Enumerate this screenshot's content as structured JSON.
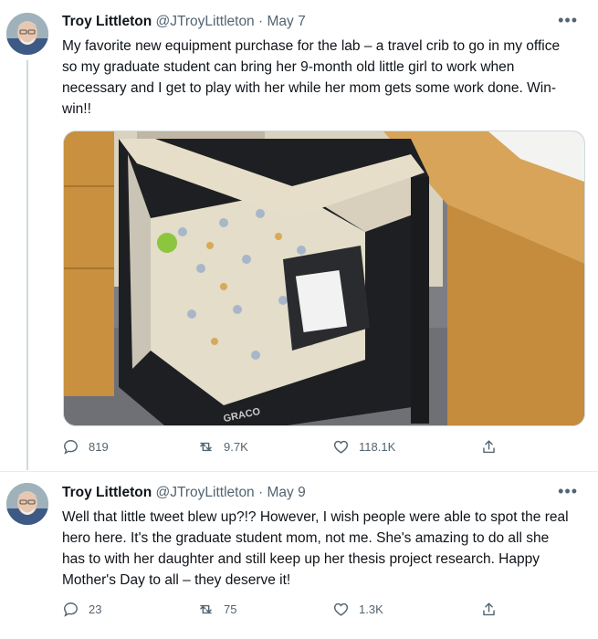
{
  "tweets": [
    {
      "author_name": "Troy Littleton",
      "handle": "@JTroyLittleton",
      "separator": "·",
      "date": "May 7",
      "more": "•••",
      "text": "My favorite new equipment purchase for the lab – a travel crib to go in my office so my graduate student can bring her 9-month old little girl to work when necessary and I get to play with her while her mom gets some work done. Win-win!!",
      "media_logo": "GRACO",
      "replies": "819",
      "retweets": "9.7K",
      "likes": "118.1K"
    },
    {
      "author_name": "Troy Littleton",
      "handle": "@JTroyLittleton",
      "separator": "·",
      "date": "May 9",
      "more": "•••",
      "text": "Well that little tweet blew up?!? However, I wish people were able to spot the real hero here. It's the graduate student mom, not me. She's amazing to do all she has to with her daughter and still keep up her thesis project research. Happy Mother's Day to all – they deserve it!",
      "replies": "23",
      "retweets": "75",
      "likes": "1.3K"
    }
  ],
  "icons": [
    "reply-icon",
    "retweet-icon",
    "like-icon",
    "share-icon",
    "more-icon"
  ],
  "colors": {
    "text": "#0f1419",
    "meta": "#536471",
    "line": "#cfd9de"
  }
}
